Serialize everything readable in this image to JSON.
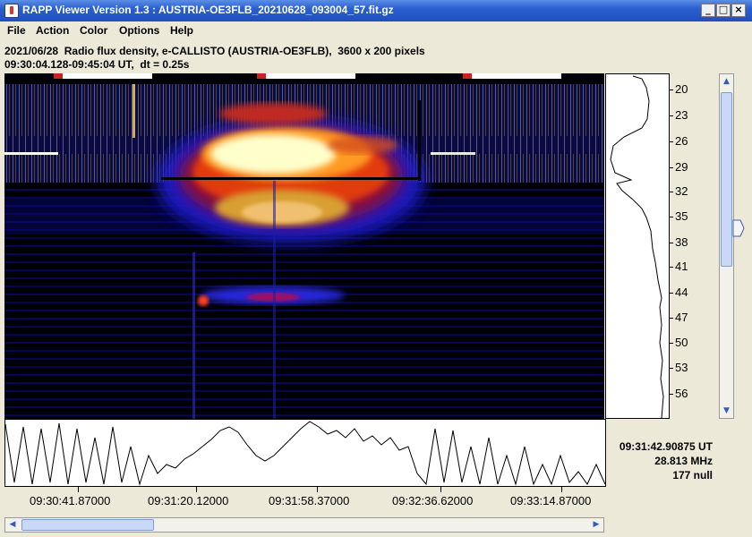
{
  "window": {
    "title": "RAPP Viewer Version 1.3 : AUSTRIA-OE3FLB_20210628_093004_57.fit.gz"
  },
  "menu": [
    {
      "label": "File"
    },
    {
      "label": "Action"
    },
    {
      "label": "Color"
    },
    {
      "label": "Options"
    },
    {
      "label": "Help"
    }
  ],
  "info": {
    "line1": "2021/06/28  Radio flux density, e-CALLISTO (AUSTRIA-OE3FLB),  3600 x 200 pixels",
    "line2": "09:30:04.128-09:45:04 UT,  dt = 0.25s"
  },
  "frequency_axis": {
    "labels": [
      "20",
      "23",
      "26",
      "29",
      "32",
      "35",
      "38",
      "41",
      "44",
      "47",
      "50",
      "53",
      "56"
    ]
  },
  "time_axis": {
    "labels": [
      "09:30:41.87000",
      "09:31:20.12000",
      "09:31:58.37000",
      "09:32:36.62000",
      "09:33:14.87000"
    ]
  },
  "cursor_readout": {
    "time": "09:31:42.90875 UT",
    "frequency": "28.813 MHz",
    "value": "177 null"
  },
  "colors": {
    "titlebar": "#2a5fcf",
    "plot_background": "#000000",
    "burst_hot": "#ffffcc"
  }
}
